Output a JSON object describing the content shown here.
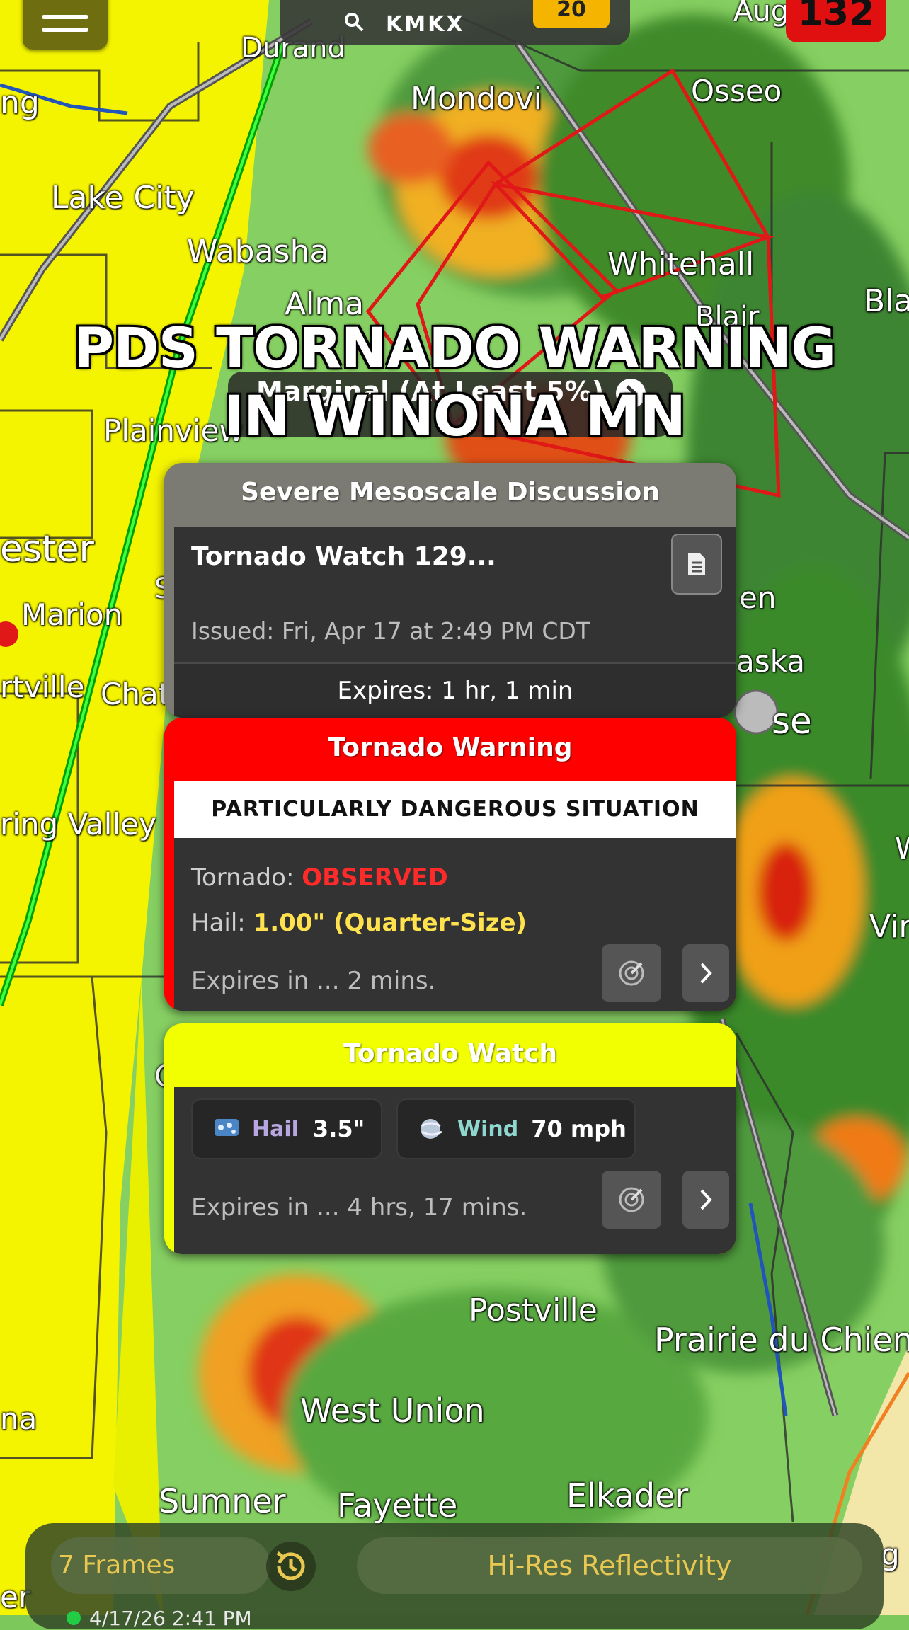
{
  "top": {
    "search_query": "KMKX",
    "alert_count": "20",
    "red_badge": "132"
  },
  "map_labels": {
    "durand": "Durand",
    "ng": "ng",
    "mondovi": "Mondovi",
    "osseo": "Osseo",
    "aug": "Aug",
    "lake_city": "Lake City",
    "wabasha": "Wabasha",
    "whitehall": "Whitehall",
    "bla": "Bla",
    "alma": "Alma",
    "blair": "Blair",
    "plainview": "Plainview",
    "ester": "ester",
    "marion": "Marion",
    "rtville": "rtville",
    "chat": "Chat",
    "s_frag": "S",
    "en": "en",
    "aska": "aska",
    "se": "se",
    "ring_valley": "ring Valley",
    "w_frag": "W",
    "vir": "Vir",
    "c_frag": "C",
    "postville": "Postville",
    "prairie": "Prairie du Chien",
    "west_union": "West Union",
    "na": "na",
    "sumner": "Sumner",
    "fayette": "Fayette",
    "elkader": "Elkader",
    "g_frag": "g",
    "er_frag": "er"
  },
  "overlay": {
    "line1": "PDS TORNADO WARNING",
    "line2": "IN WINONA MN",
    "marginal": "Marginal (At Least 5%)"
  },
  "colors": {
    "warning_red": "#ff0000",
    "watch_yellow": "#f2ff00",
    "discussion_gray": "#7b7b73",
    "observed_red": "#ff2a2a",
    "hail_yellow": "#ffe24d",
    "hail_purple": "#b8a6e0",
    "wind_teal": "#8fd6cf"
  },
  "discussion": {
    "header": "Severe Mesoscale Discussion",
    "title": "Tornado Watch 129...",
    "issued": "Issued: Fri, Apr 17 at 2:49 PM CDT",
    "expires": "Expires: 1 hr, 1 min",
    "doc_icon": "document-icon"
  },
  "warning": {
    "header": "Tornado Warning",
    "banner": "PARTICULARLY DANGEROUS SITUATION",
    "tornado_label": "Tornado:",
    "tornado_value": "OBSERVED",
    "hail_label": "Hail:",
    "hail_value": "1.00\" (Quarter-Size)",
    "expires": "Expires in ... 2 mins.",
    "radar_icon": "radar-icon",
    "chevron_icon": "chevron-right-icon"
  },
  "watch": {
    "header": "Tornado Watch",
    "hail_label": "Hail",
    "hail_value": "3.5\"",
    "wind_label": "Wind",
    "wind_value": "70 mph",
    "expires": "Expires in ... 4 hrs, 17 mins.",
    "hail_icon": "hail-icon",
    "wind_icon": "wind-icon"
  },
  "bottom": {
    "frames": "7 Frames",
    "layer": "Hi-Res Reflectivity",
    "timestamp": "4/17/26 2:41 PM",
    "history_icon": "history-icon"
  }
}
